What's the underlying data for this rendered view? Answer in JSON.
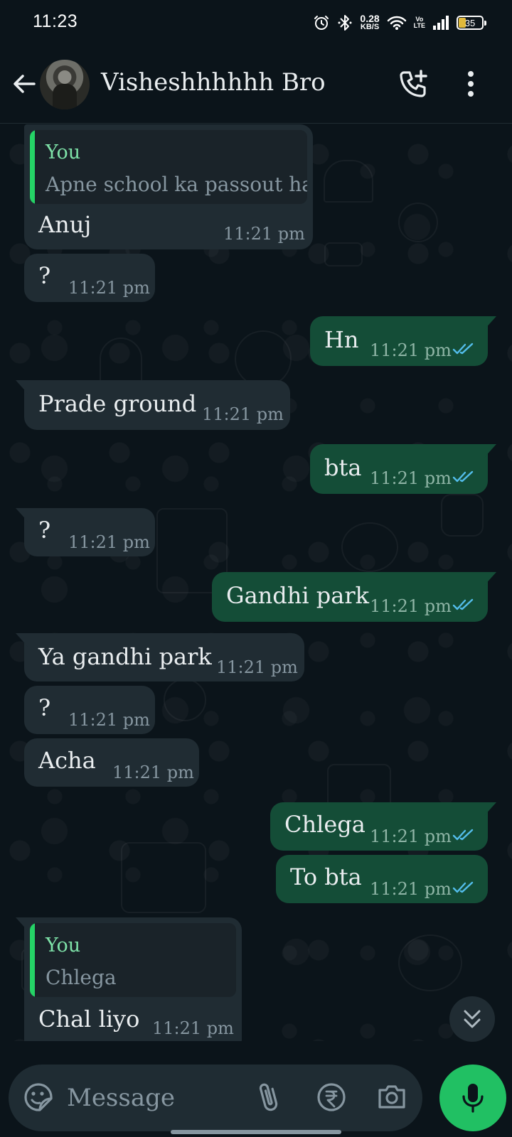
{
  "status_bar": {
    "time": "11:23",
    "net_speed_value": "0.28",
    "net_speed_unit": "KB/S",
    "volte_top": "Vo",
    "volte_bottom": "LTE",
    "battery": "35"
  },
  "header": {
    "contact_name": "Visheshhhhhh Bro",
    "icons": [
      "back-arrow-icon",
      "avatar",
      "add-call-icon",
      "more-vert-icon"
    ]
  },
  "messages": [
    {
      "dir": "in",
      "quote_author": "You",
      "quote_text": "Apne school ka passout hai",
      "text": "Anuj",
      "time": "11:21 pm"
    },
    {
      "dir": "in",
      "text": "?",
      "time": "11:21 pm"
    },
    {
      "dir": "out",
      "text": "Hn",
      "time": "11:21 pm",
      "status": "read"
    },
    {
      "dir": "in",
      "text": "Prade ground",
      "time": "11:21 pm"
    },
    {
      "dir": "out",
      "text": "bta",
      "time": "11:21 pm",
      "status": "read"
    },
    {
      "dir": "in",
      "text": "?",
      "time": "11:21 pm"
    },
    {
      "dir": "out",
      "text": "Gandhi park",
      "time": "11:21 pm",
      "status": "read"
    },
    {
      "dir": "in",
      "text": "Ya gandhi park",
      "time": "11:21 pm"
    },
    {
      "dir": "in",
      "text": "?",
      "time": "11:21 pm"
    },
    {
      "dir": "in",
      "text": "Acha",
      "time": "11:21 pm"
    },
    {
      "dir": "out",
      "text": "Chlega",
      "time": "11:21 pm",
      "status": "read"
    },
    {
      "dir": "out",
      "text": "To bta",
      "time": "11:21 pm",
      "status": "read"
    },
    {
      "dir": "in",
      "quote_author": "You",
      "quote_text": "Chlega",
      "text": "Chal liyo",
      "time": "11:21 pm"
    }
  ],
  "composer": {
    "placeholder": "Message",
    "icons": [
      "sticker-emoji-icon",
      "attach-paperclip-icon",
      "rupee-payment-icon",
      "camera-icon",
      "mic-icon"
    ]
  },
  "colors": {
    "background": "#0b141a",
    "incoming_bubble": "#202c33",
    "outgoing_bubble": "#144d37",
    "accent_green": "#21c063",
    "read_ticks": "#53bdeb"
  }
}
